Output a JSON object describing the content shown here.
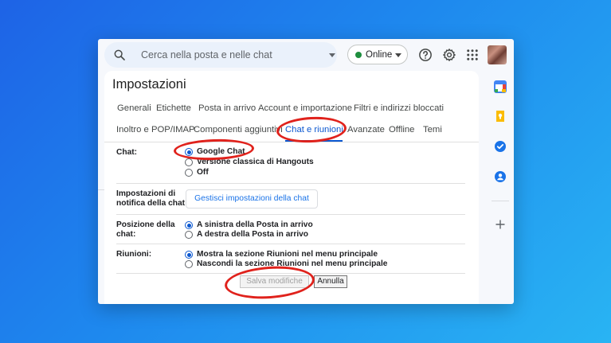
{
  "search": {
    "placeholder": "Cerca nella posta e nelle chat"
  },
  "status": {
    "label": "Online",
    "color": "#1e8e3e"
  },
  "top_icons": [
    "help-icon",
    "gear-icon",
    "apps-grid-icon"
  ],
  "side_apps": [
    "calendar-icon",
    "keep-icon",
    "tasks-icon",
    "contacts-icon",
    "add-icon"
  ],
  "page": {
    "title": "Impostazioni"
  },
  "tabs": [
    {
      "label": "Generali"
    },
    {
      "label": "Etichette"
    },
    {
      "label": "Posta in arrivo"
    },
    {
      "label": "Account e importazione"
    },
    {
      "label": "Filtri e indirizzi bloccati"
    },
    {
      "label": "Inoltro e POP/IMAP"
    },
    {
      "label": "Componenti aggiuntivi"
    },
    {
      "label": "Chat e riunioni",
      "active": true
    },
    {
      "label": "Avanzate"
    },
    {
      "label": "Offline"
    },
    {
      "label": "Temi"
    }
  ],
  "settings": {
    "chat": {
      "label": "Chat:",
      "options": [
        {
          "label": "Google Chat",
          "selected": true
        },
        {
          "label": "Versione classica di Hangouts",
          "selected": false
        },
        {
          "label": "Off",
          "selected": false
        }
      ]
    },
    "notifications": {
      "label_line1": "Impostazioni di",
      "label_line2": "notifica della chat:",
      "button": "Gestisci impostazioni della chat"
    },
    "position": {
      "label_line1": "Posizione della",
      "label_line2": "chat:",
      "options": [
        {
          "label": "A sinistra della Posta in arrivo",
          "selected": true
        },
        {
          "label": "A destra della Posta in arrivo",
          "selected": false
        }
      ]
    },
    "meetings": {
      "label": "Riunioni:",
      "options": [
        {
          "label": "Mostra la sezione Riunioni nel menu principale",
          "selected": true
        },
        {
          "label": "Nascondi la sezione Riunioni nel menu principale",
          "selected": false
        }
      ]
    }
  },
  "actions": {
    "save": "Salva modifiche",
    "cancel": "Annulla"
  },
  "colors": {
    "accent": "#0b57d0",
    "annotation": "#e0221c"
  }
}
